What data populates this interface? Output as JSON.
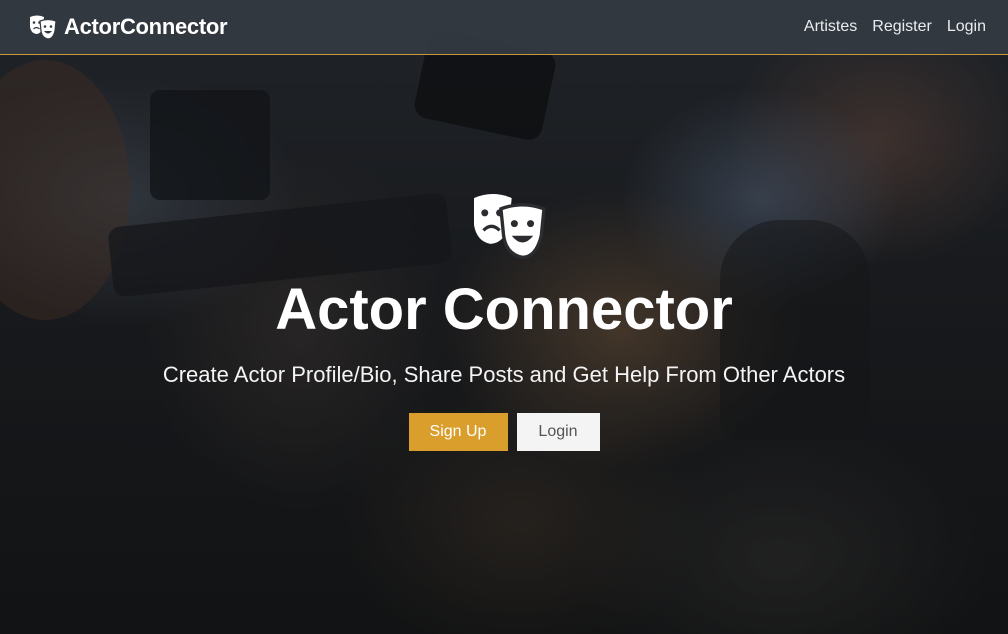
{
  "navbar": {
    "brand": "ActorConnector",
    "links": [
      "Artistes",
      "Register",
      "Login"
    ]
  },
  "hero": {
    "title": "Actor Connector",
    "subtitle": "Create Actor Profile/Bio, Share Posts and Get Help From Other Actors",
    "signup_label": "Sign Up",
    "login_label": "Login"
  },
  "icons": {
    "brand": "theater-masks-icon",
    "hero": "theater-masks-icon"
  },
  "colors": {
    "accent": "#d99e2c",
    "navbar_bg": "#343a42",
    "navbar_border": "#c79a3a",
    "login_button_bg": "#f4f4f4"
  }
}
